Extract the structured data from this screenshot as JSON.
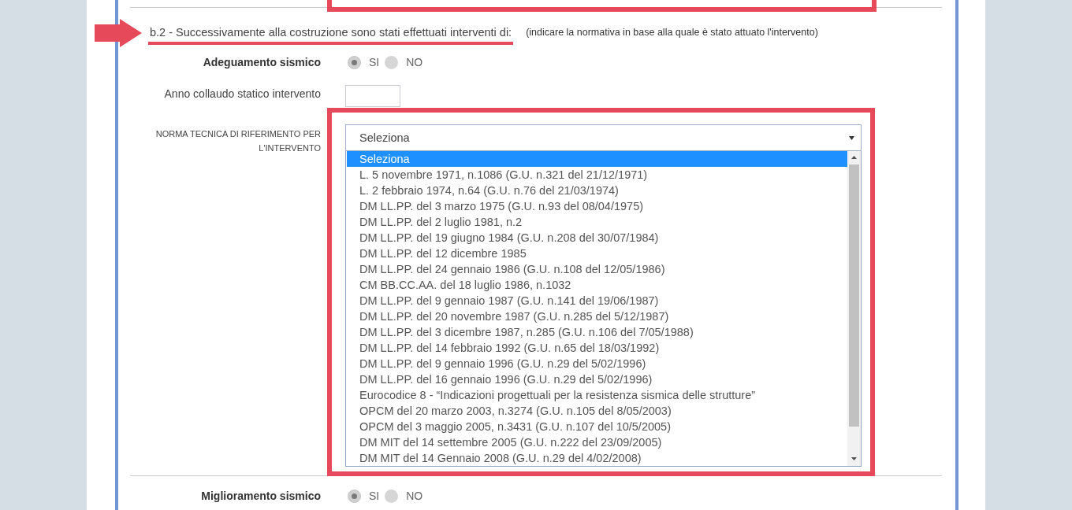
{
  "highlight_above": true,
  "sections": [
    {
      "title": "b.2 - Successivamente alla costruzione sono stati effettuati interventi di:",
      "note": "(indicare la normativa in base alla quale è stato attuato l'intervento)",
      "highlighted": true,
      "fields": [
        {
          "kind": "radio",
          "label": "Adeguamento sismico",
          "options": [
            {
              "label": "SI",
              "selected": true
            },
            {
              "label": "NO",
              "selected": false
            }
          ]
        },
        {
          "kind": "text",
          "label": "Anno collaudo statico intervento"
        },
        {
          "kind": "select",
          "label": "NORMA TECNICA DI RIFERIMENTO PER L'INTERVENTO",
          "value": "Seleziona",
          "expanded": true,
          "highlighted": true,
          "options": [
            {
              "label": "Seleziona",
              "selected": true
            },
            {
              "label": "L. 5 novembre 1971, n.1086 (G.U. n.321 del 21/12/1971)",
              "selected": false
            },
            {
              "label": "L. 2 febbraio 1974, n.64 (G.U. n.76 del 21/03/1974)",
              "selected": false
            },
            {
              "label": "DM LL.PP. del 3 marzo 1975 (G.U. n.93 del 08/04/1975)",
              "selected": false
            },
            {
              "label": "DM LL.PP. del 2 luglio 1981, n.2",
              "selected": false
            },
            {
              "label": "DM LL.PP. del 19 giugno 1984 (G.U. n.208 del 30/07/1984)",
              "selected": false
            },
            {
              "label": "DM LL.PP. del 12 dicembre 1985",
              "selected": false
            },
            {
              "label": "DM LL.PP. del 24 gennaio 1986 (G.U. n.108 del 12/05/1986)",
              "selected": false
            },
            {
              "label": "CM BB.CC.AA. del 18 luglio 1986, n.1032",
              "selected": false
            },
            {
              "label": "DM LL.PP. del 9 gennaio 1987 (G.U. n.141 del 19/06/1987)",
              "selected": false
            },
            {
              "label": "DM LL.PP. del 20 novembre 1987 (G.U. n.285 del 5/12/1987)",
              "selected": false
            },
            {
              "label": "DM LL.PP. del 3 dicembre 1987, n.285 (G.U. n.106 del 7/05/1988)",
              "selected": false
            },
            {
              "label": "DM LL.PP. del 14 febbraio 1992 (G.U. n.65 del 18/03/1992)",
              "selected": false
            },
            {
              "label": "DM LL.PP. del 9 gennaio 1996 (G.U. n.29 del 5/02/1996)",
              "selected": false
            },
            {
              "label": "DM LL.PP. del 16 gennaio 1996 (G.U. n.29 del 5/02/1996)",
              "selected": false
            },
            {
              "label": "Eurocodice 8 - “Indicazioni progettuali per la resistenza sismica delle strutture”",
              "selected": false
            },
            {
              "label": "OPCM del 20 marzo 2003, n.3274 (G.U. n.105 del 8/05/2003)",
              "selected": false
            },
            {
              "label": "OPCM del 3 maggio 2005, n.3431 (G.U. n.107 del 10/5/2005)",
              "selected": false
            },
            {
              "label": "DM MIT del 14 settembre 2005 (G.U. n.222 del 23/09/2005)",
              "selected": false
            },
            {
              "label": "DM MIT del 14 Gennaio 2008 (G.U. n.29 del 4/02/2008)",
              "selected": false
            }
          ]
        }
      ]
    },
    {
      "fields": [
        {
          "kind": "radio",
          "label": "Miglioramento sismico",
          "options": [
            {
              "label": "SI",
              "selected": true
            },
            {
              "label": "NO",
              "selected": false
            }
          ]
        }
      ]
    }
  ]
}
